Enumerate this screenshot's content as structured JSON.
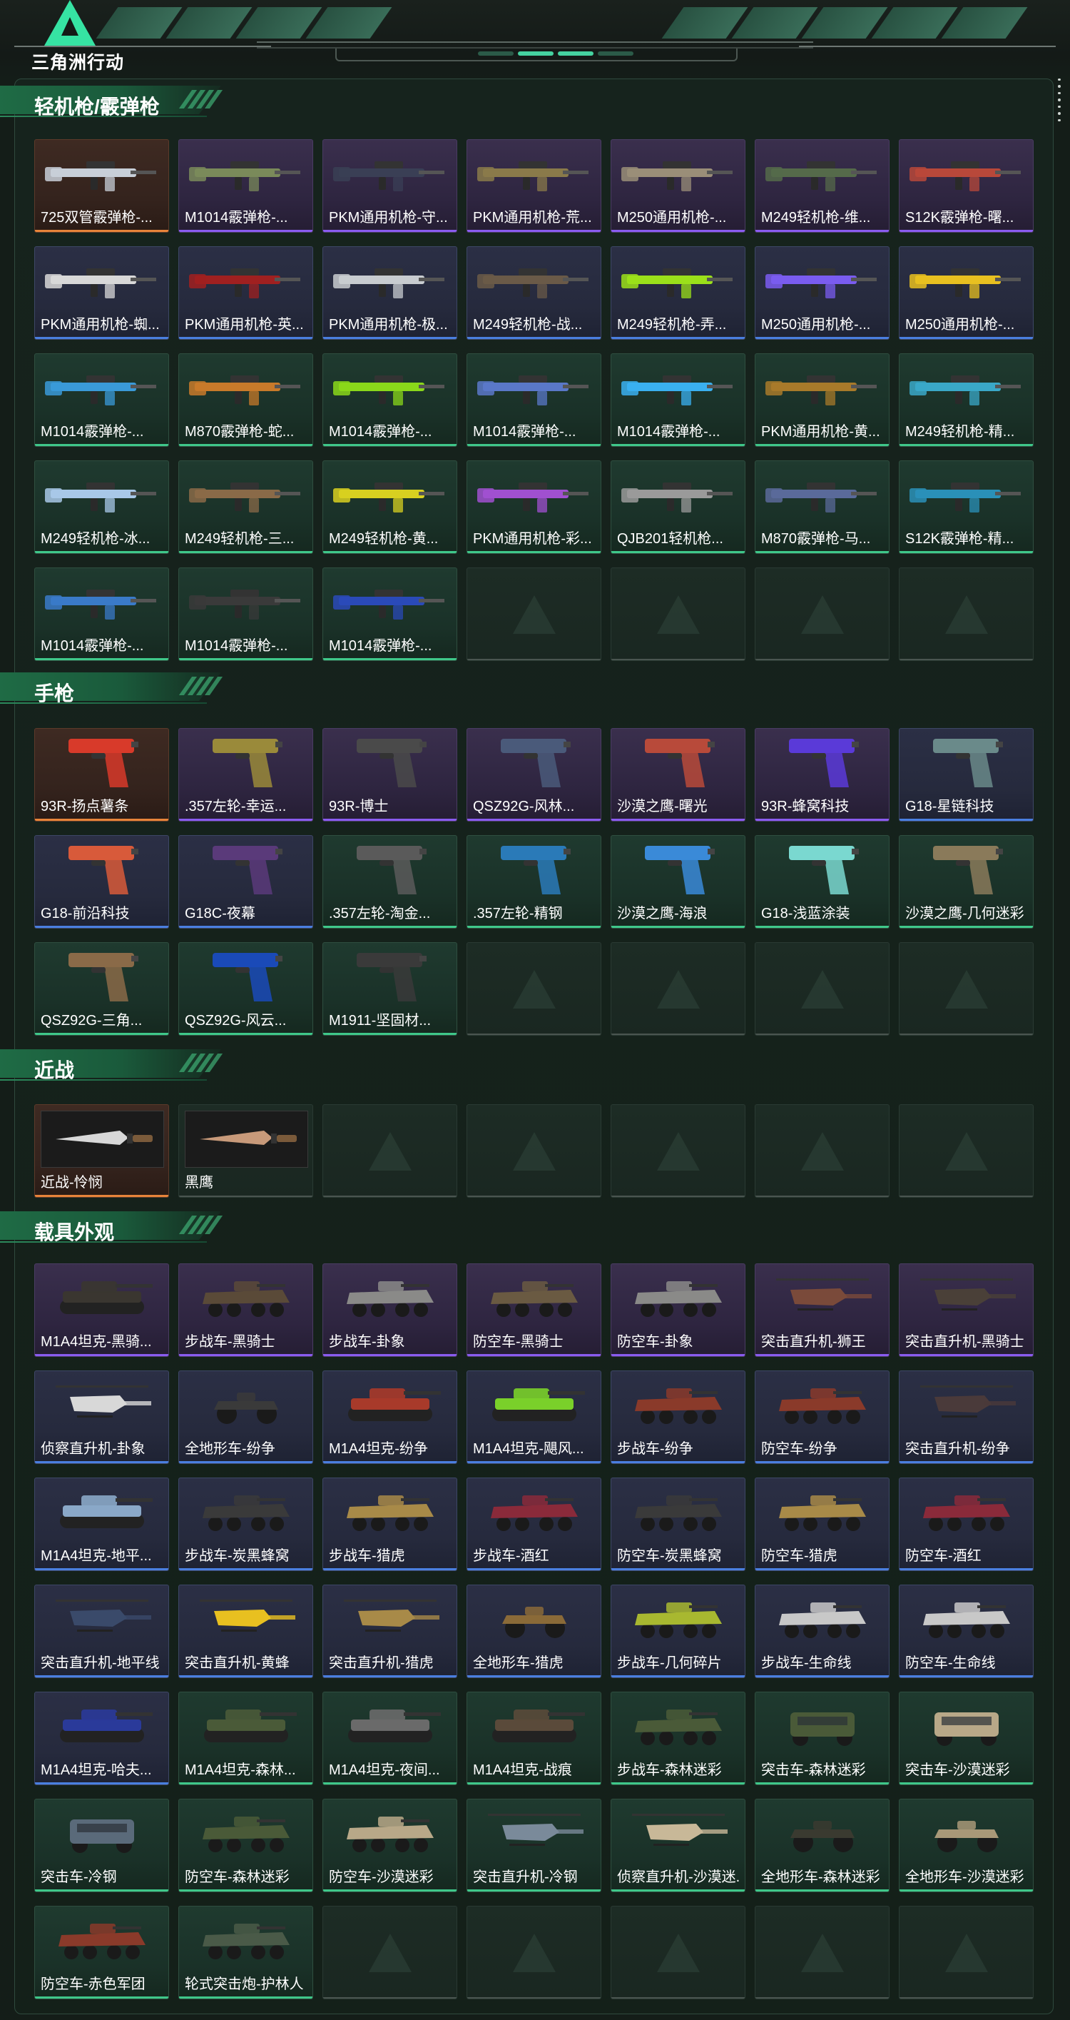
{
  "app": {
    "logo_text": "三角洲行动"
  },
  "colors": {
    "purple": "#8a5cf0",
    "blue": "#4a7fe0",
    "green": "#3fc88a",
    "orange": "#e8843a",
    "accent": "#36e3a3"
  },
  "sections": [
    {
      "title": "轻机枪/霰弹枪",
      "kind": "gun",
      "rows": [
        [
          {
            "name": "725双管霰弹枪-...",
            "rarity": "orange",
            "color": "#c8cfd8"
          },
          {
            "name": "M1014霰弹枪-...",
            "rarity": "purple",
            "color": "#7a8a5a"
          },
          {
            "name": "PKM通用机枪-守...",
            "rarity": "purple",
            "color": "#3a3f55"
          },
          {
            "name": "PKM通用机枪-荒...",
            "rarity": "purple",
            "color": "#8a7a4a"
          },
          {
            "name": "M250通用机枪-...",
            "rarity": "purple",
            "color": "#9a8e78"
          },
          {
            "name": "M249轻机枪-维...",
            "rarity": "purple",
            "color": "#556a4a"
          },
          {
            "name": "S12K霰弹枪-曙...",
            "rarity": "purple",
            "color": "#b8483a"
          }
        ],
        [
          {
            "name": "PKM通用机枪-蜘...",
            "rarity": "blue",
            "color": "#d8d8d8"
          },
          {
            "name": "PKM通用机枪-英...",
            "rarity": "blue",
            "color": "#a02020"
          },
          {
            "name": "PKM通用机枪-极...",
            "rarity": "blue",
            "color": "#c8ccd0"
          },
          {
            "name": "M249轻机枪-战...",
            "rarity": "blue",
            "color": "#6a5a48"
          },
          {
            "name": "M249轻机枪-弄...",
            "rarity": "blue",
            "color": "#9be01a"
          },
          {
            "name": "M250通用机枪-...",
            "rarity": "blue",
            "color": "#7a5cf0"
          },
          {
            "name": "M250通用机枪-...",
            "rarity": "blue",
            "color": "#e8c020"
          }
        ],
        [
          {
            "name": "M1014霰弹枪-...",
            "rarity": "green",
            "color": "#3a9ad8"
          },
          {
            "name": "M870霰弹枪-蛇...",
            "rarity": "green",
            "color": "#c87a2a"
          },
          {
            "name": "M1014霰弹枪-...",
            "rarity": "green",
            "color": "#8ad81a"
          },
          {
            "name": "M1014霰弹枪-...",
            "rarity": "green",
            "color": "#5a78c8"
          },
          {
            "name": "M1014霰弹枪-...",
            "rarity": "green",
            "color": "#3ab0f0"
          },
          {
            "name": "PKM通用机枪-黄...",
            "rarity": "green",
            "color": "#a87a2a"
          },
          {
            "name": "M249轻机枪-精...",
            "rarity": "green",
            "color": "#3aa8c8"
          }
        ],
        [
          {
            "name": "M249轻机枪-冰...",
            "rarity": "green",
            "color": "#a8c8e8"
          },
          {
            "name": "M249轻机枪-三...",
            "rarity": "green",
            "color": "#8a6a48"
          },
          {
            "name": "M249轻机枪-黄...",
            "rarity": "green",
            "color": "#d8d020"
          },
          {
            "name": "PKM通用机枪-彩...",
            "rarity": "green",
            "color": "#a050d0"
          },
          {
            "name": "QJB201轻机枪...",
            "rarity": "green",
            "color": "#9a9a9a"
          },
          {
            "name": "M870霰弹枪-马...",
            "rarity": "green",
            "color": "#5a6a9a"
          },
          {
            "name": "S12K霰弹枪-精...",
            "rarity": "green",
            "color": "#2a90b8"
          }
        ],
        [
          {
            "name": "M1014霰弹枪-...",
            "rarity": "green",
            "color": "#3a7ac8"
          },
          {
            "name": "M1014霰弹枪-...",
            "rarity": "green",
            "color": "#3a3a3a"
          },
          {
            "name": "M1014霰弹枪-...",
            "rarity": "green",
            "color": "#2a4ab8"
          },
          {
            "empty": true
          },
          {
            "empty": true
          },
          {
            "empty": true
          },
          {
            "empty": true
          }
        ]
      ]
    },
    {
      "title": "手枪",
      "kind": "pistol",
      "rows": [
        [
          {
            "name": "93R-扬点薯条",
            "rarity": "orange",
            "color": "#d83a2a"
          },
          {
            "name": ".357左轮-幸运...",
            "rarity": "purple",
            "color": "#9a8a3a"
          },
          {
            "name": "93R-博士",
            "rarity": "purple",
            "color": "#4a4a4a"
          },
          {
            "name": "QSZ92G-风林...",
            "rarity": "purple",
            "color": "#4a5a7a"
          },
          {
            "name": "沙漠之鹰-曙光",
            "rarity": "purple",
            "color": "#b84a3a"
          },
          {
            "name": "93R-蜂窝科技",
            "rarity": "purple",
            "color": "#5a3ad8"
          },
          {
            "name": "G18-星链科技",
            "rarity": "blue",
            "color": "#6a8a8a"
          }
        ],
        [
          {
            "name": "G18-前沿科技",
            "rarity": "blue",
            "color": "#d85a3a"
          },
          {
            "name": "G18C-夜幕",
            "rarity": "blue",
            "color": "#5a3a7a"
          },
          {
            "name": ".357左轮-淘金...",
            "rarity": "green",
            "color": "#5a5a5a"
          },
          {
            "name": ".357左轮-精钢",
            "rarity": "green",
            "color": "#2a7ab8"
          },
          {
            "name": "沙漠之鹰-海浪",
            "rarity": "green",
            "color": "#3a8ad8"
          },
          {
            "name": "G18-浅蓝涂装",
            "rarity": "green",
            "color": "#7ad8d0"
          },
          {
            "name": "沙漠之鹰-几何迷彩",
            "rarity": "green",
            "color": "#8a7a5a"
          }
        ],
        [
          {
            "name": "QSZ92G-三角...",
            "rarity": "green",
            "color": "#8a6a48"
          },
          {
            "name": "QSZ92G-风云...",
            "rarity": "green",
            "color": "#1a4ab8"
          },
          {
            "name": "M1911-坚固材...",
            "rarity": "green",
            "color": "#3a3a3a"
          },
          {
            "empty": true
          },
          {
            "empty": true
          },
          {
            "empty": true
          },
          {
            "empty": true
          }
        ]
      ]
    },
    {
      "title": "近战",
      "kind": "knife",
      "rows": [
        [
          {
            "name": "近战-怜悯",
            "rarity": "orange",
            "color": "#d8d8d8"
          },
          {
            "name": "黑鹰",
            "rarity": "empty-named",
            "color": "#c89a7a"
          },
          {
            "empty": true
          },
          {
            "empty": true
          },
          {
            "empty": true
          },
          {
            "empty": true
          },
          {
            "empty": true
          }
        ]
      ]
    },
    {
      "title": "载具外观",
      "kind": "vehicle",
      "rows": [
        [
          {
            "name": "M1A4坦克-黑骑...",
            "rarity": "purple",
            "color": "#3a3630",
            "v": "tank"
          },
          {
            "name": "步战车-黑骑士",
            "rarity": "purple",
            "color": "#5a4a38",
            "v": "apc"
          },
          {
            "name": "步战车-卦象",
            "rarity": "purple",
            "color": "#8a8a88",
            "v": "apc"
          },
          {
            "name": "防空车-黑骑士",
            "rarity": "purple",
            "color": "#6a5a42",
            "v": "apc"
          },
          {
            "name": "防空车-卦象",
            "rarity": "purple",
            "color": "#8a8a88",
            "v": "apc"
          },
          {
            "name": "突击直升机-狮王",
            "rarity": "purple",
            "color": "#7a4a3a",
            "v": "heli"
          },
          {
            "name": "突击直升机-黑骑士",
            "rarity": "purple",
            "color": "#4a4038",
            "v": "heli"
          }
        ],
        [
          {
            "name": "侦察直升机-卦象",
            "rarity": "blue",
            "color": "#d8d8d8",
            "v": "heli"
          },
          {
            "name": "全地形车-纷争",
            "rarity": "blue",
            "color": "#3a3a3a",
            "v": "atv"
          },
          {
            "name": "M1A4坦克-纷争",
            "rarity": "blue",
            "color": "#a83a2a",
            "v": "tank"
          },
          {
            "name": "M1A4坦克-飓风...",
            "rarity": "blue",
            "color": "#7ad02a",
            "v": "tank"
          },
          {
            "name": "步战车-纷争",
            "rarity": "blue",
            "color": "#8a3a2a",
            "v": "apc"
          },
          {
            "name": "防空车-纷争",
            "rarity": "blue",
            "color": "#8a3a2a",
            "v": "apc"
          },
          {
            "name": "突击直升机-纷争",
            "rarity": "blue",
            "color": "#4a3a3a",
            "v": "heli"
          }
        ],
        [
          {
            "name": "M1A4坦克-地平...",
            "rarity": "blue",
            "color": "#8aa8c8",
            "v": "tank"
          },
          {
            "name": "步战车-炭黑蜂窝",
            "rarity": "blue",
            "color": "#3a3a3a",
            "v": "apc"
          },
          {
            "name": "步战车-猎虎",
            "rarity": "blue",
            "color": "#a88a48",
            "v": "apc"
          },
          {
            "name": "步战车-酒红",
            "rarity": "blue",
            "color": "#8a2a3a",
            "v": "apc"
          },
          {
            "name": "防空车-炭黑蜂窝",
            "rarity": "blue",
            "color": "#3a3a3a",
            "v": "apc"
          },
          {
            "name": "防空车-猎虎",
            "rarity": "blue",
            "color": "#a88a48",
            "v": "apc"
          },
          {
            "name": "防空车-酒红",
            "rarity": "blue",
            "color": "#8a2a3a",
            "v": "apc"
          }
        ],
        [
          {
            "name": "突击直升机-地平线",
            "rarity": "blue",
            "color": "#3a4a6a",
            "v": "heli"
          },
          {
            "name": "突击直升机-黄蜂",
            "rarity": "blue",
            "color": "#e8c020",
            "v": "heli"
          },
          {
            "name": "突击直升机-猎虎",
            "rarity": "blue",
            "color": "#a88a48",
            "v": "heli"
          },
          {
            "name": "全地形车-猎虎",
            "rarity": "blue",
            "color": "#8a6a38",
            "v": "atv"
          },
          {
            "name": "步战车-几何碎片",
            "rarity": "blue",
            "color": "#a8b830",
            "v": "apc"
          },
          {
            "name": "步战车-生命线",
            "rarity": "blue",
            "color": "#c8c8c8",
            "v": "apc"
          },
          {
            "name": "防空车-生命线",
            "rarity": "blue",
            "color": "#c8c8c8",
            "v": "apc"
          }
        ],
        [
          {
            "name": "M1A4坦克-哈夫...",
            "rarity": "blue",
            "color": "#2a3a9a",
            "v": "tank"
          },
          {
            "name": "M1A4坦克-森林...",
            "rarity": "green",
            "color": "#4a5a38",
            "v": "tank"
          },
          {
            "name": "M1A4坦克-夜间...",
            "rarity": "green",
            "color": "#6a6a6a",
            "v": "tank"
          },
          {
            "name": "M1A4坦克-战痕",
            "rarity": "green",
            "color": "#5a4a3a",
            "v": "tank"
          },
          {
            "name": "步战车-森林迷彩",
            "rarity": "green",
            "color": "#4a5a38",
            "v": "apc"
          },
          {
            "name": "突击车-森林迷彩",
            "rarity": "green",
            "color": "#4a5a38",
            "v": "car"
          },
          {
            "name": "突击车-沙漠迷彩",
            "rarity": "green",
            "color": "#b8a888",
            "v": "car"
          }
        ],
        [
          {
            "name": "突击车-冷钢",
            "rarity": "green",
            "color": "#5a6a7a",
            "v": "car"
          },
          {
            "name": "防空车-森林迷彩",
            "rarity": "green",
            "color": "#4a5a38",
            "v": "apc"
          },
          {
            "name": "防空车-沙漠迷彩",
            "rarity": "green",
            "color": "#b8a888",
            "v": "apc"
          },
          {
            "name": "突击直升机-冷钢",
            "rarity": "green",
            "color": "#7a8a9a",
            "v": "heli"
          },
          {
            "name": "侦察直升机-沙漠迷...",
            "rarity": "green",
            "color": "#c8b898",
            "v": "heli"
          },
          {
            "name": "全地形车-森林迷彩",
            "rarity": "green",
            "color": "#3a3a30",
            "v": "atv"
          },
          {
            "name": "全地形车-沙漠迷彩",
            "rarity": "green",
            "color": "#a89878",
            "v": "atv"
          }
        ],
        [
          {
            "name": "防空车-赤色军团",
            "rarity": "green",
            "color": "#8a3a2a",
            "v": "apc"
          },
          {
            "name": "轮式突击炮-护林人",
            "rarity": "green",
            "color": "#4a5a48",
            "v": "apc"
          },
          {
            "empty": true
          },
          {
            "empty": true
          },
          {
            "empty": true
          },
          {
            "empty": true
          },
          {
            "empty": true
          }
        ]
      ]
    }
  ]
}
